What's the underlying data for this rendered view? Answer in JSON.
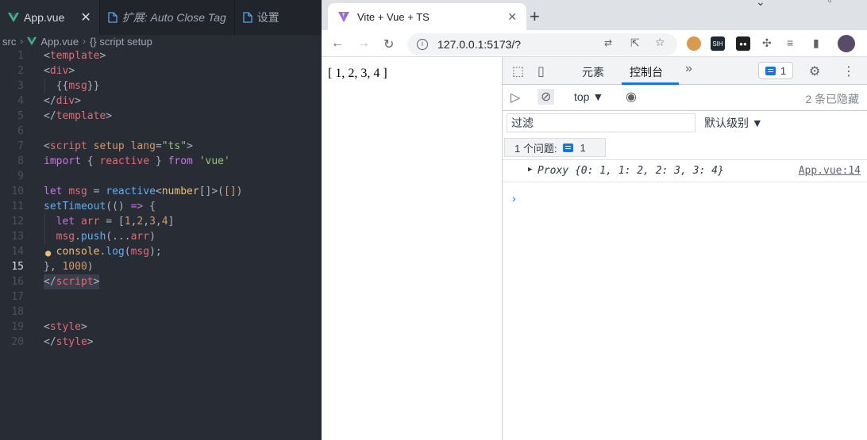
{
  "editor": {
    "tabs": [
      {
        "label": "App.vue",
        "close": "✕"
      },
      {
        "label": "扩展: Auto Close Tag"
      },
      {
        "label": "设置"
      }
    ],
    "breadcrumb": {
      "folder": "src",
      "file": "App.vue",
      "symbol": "{} script setup"
    },
    "line_numbers": [
      "1",
      "2",
      "3",
      "4",
      "5",
      "6",
      "7",
      "8",
      "9",
      "10",
      "11",
      "12",
      "13",
      "14",
      "15",
      "16",
      "17",
      "18",
      "19",
      "20"
    ]
  },
  "browser": {
    "tab_title": "Vite + Vue + TS",
    "tab_close": "✕",
    "new_tab": "+",
    "url": "127.0.0.1:5173/?",
    "page_text": "[ 1, 2, 3, 4 ]"
  },
  "devtools": {
    "tabs": [
      "元素",
      "控制台"
    ],
    "more": "»",
    "issue_count": "1",
    "context": "top ▼",
    "hidden": "2 条已隐藏",
    "filter_placeholder": "过滤",
    "levels": "默认级别 ▼",
    "issues_label": "1 个问题:",
    "issues_count": "1",
    "log_text": "Proxy {0: 1, 1: 2, 2: 3, 3: 4}",
    "log_source": "App.vue:14",
    "prompt": "›"
  }
}
